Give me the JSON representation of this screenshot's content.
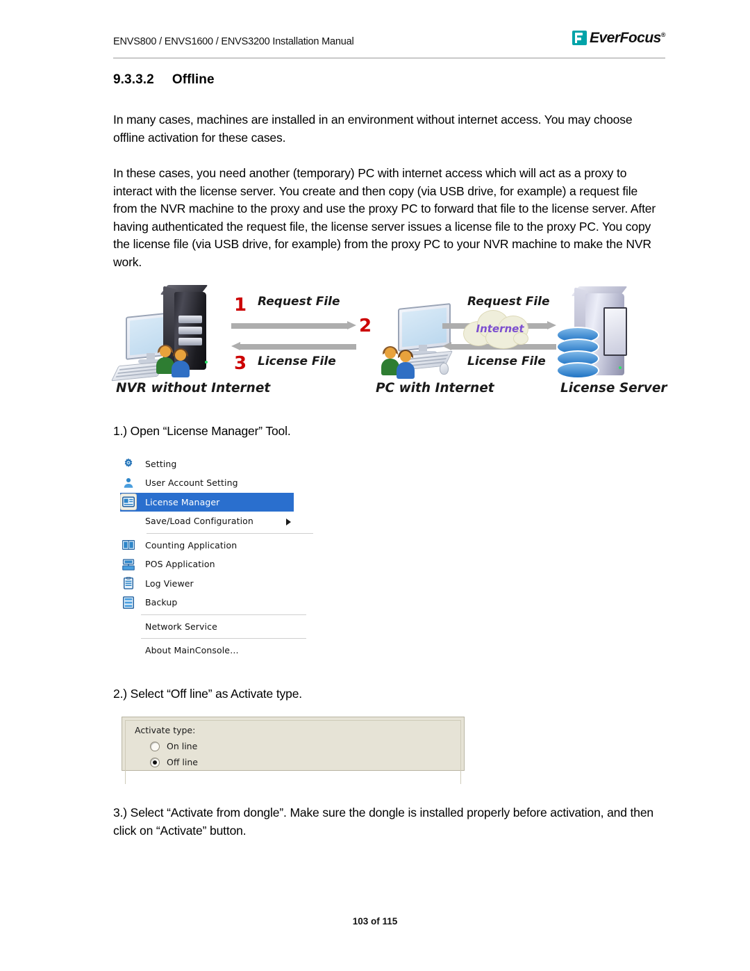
{
  "header": {
    "title": "ENVS800 / ENVS1600 / ENVS3200 Installation Manual",
    "logo_text": "EverFocus",
    "logo_reg": "®"
  },
  "section": {
    "number": "9.3.3.2",
    "title": "Offline"
  },
  "paragraphs": [
    "In many cases, machines are installed in an environment without internet access. You may choose offline activation for these cases.",
    "In these cases, you need another (temporary) PC with internet access which will act as a proxy to interact with the license server. You create and then copy (via USB drive, for example) a request file from the NVR machine to the proxy and use the proxy PC to forward that file to the license server. After having authenticated the request file, the license server issues a license file to the proxy PC. You copy the license file (via USB drive, for example) from the proxy PC to your NVR machine to make the NVR work."
  ],
  "diagram": {
    "nodes": {
      "left": "NVR without Internet",
      "middle": "PC with Internet",
      "right": "License Server"
    },
    "cloud_label": "Internet",
    "flows": {
      "left_request": "Request File",
      "left_license": "License File",
      "right_request": "Request File",
      "right_license": "License File"
    },
    "step_numbers": {
      "one": "1",
      "two": "2",
      "three": "3"
    },
    "colors": {
      "step_number": "#cc0000",
      "arrow": "#adadad",
      "cloud_text": "#7c4fd0",
      "cloud_fill": "#efeedb"
    }
  },
  "steps": {
    "step1": "1.) Open “License Manager” Tool.",
    "step2": "2.) Select “Off line” as Activate type.",
    "step3": "3.) Select “Activate from dongle”.  Make sure the dongle is installed properly before activation, and then click on “Activate” button."
  },
  "menu": {
    "selected_index": 2,
    "highlight_color": "#2a6fce",
    "items": [
      {
        "label": "Setting",
        "icon": "gear-icon",
        "has_icon": true,
        "has_submenu": false
      },
      {
        "label": "User Account Setting",
        "icon": "user-icon",
        "has_icon": true,
        "has_submenu": false
      },
      {
        "label": "License Manager",
        "icon": "license-card-icon",
        "has_icon": true,
        "has_submenu": false
      },
      {
        "label": "Save/Load Configuration",
        "icon": "",
        "has_icon": false,
        "has_submenu": true
      },
      {
        "label": "Counting Application",
        "icon": "counting-icon",
        "has_icon": true,
        "has_submenu": false
      },
      {
        "label": "POS Application",
        "icon": "pos-icon",
        "has_icon": true,
        "has_submenu": false
      },
      {
        "label": "Log Viewer",
        "icon": "clipboard-icon",
        "has_icon": true,
        "has_submenu": false
      },
      {
        "label": "Backup",
        "icon": "backup-icon",
        "has_icon": true,
        "has_submenu": false
      },
      {
        "label": "Network Service",
        "icon": "",
        "has_icon": false,
        "has_submenu": false
      },
      {
        "label": "About MainConsole…",
        "icon": "",
        "has_icon": false,
        "has_submenu": false
      }
    ]
  },
  "activate_dialog": {
    "label": "Activate type:",
    "options": [
      {
        "label": "On line",
        "selected": false
      },
      {
        "label": "Off line",
        "selected": true
      }
    ],
    "background": "#e6e3d6"
  },
  "footer": {
    "page_label": "103 of 115"
  }
}
